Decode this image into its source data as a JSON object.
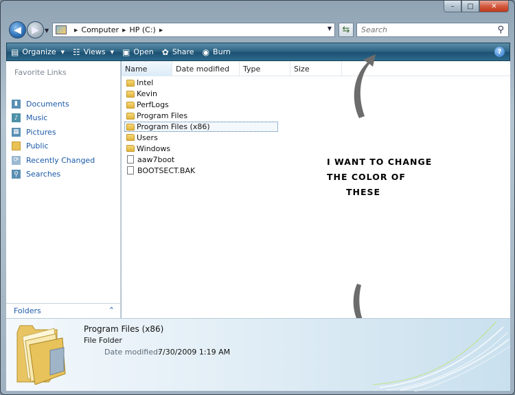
{
  "window": {
    "caption": {
      "minimize": "–",
      "maximize": "□",
      "close": "✕"
    }
  },
  "address_bar": {
    "breadcrumbs": [
      "Computer",
      "HP (C:)"
    ],
    "search_placeholder": "Search"
  },
  "toolbar": {
    "items": [
      {
        "label": "Organize",
        "icon": "organize-icon",
        "dropdown": true
      },
      {
        "label": "Views",
        "icon": "views-icon",
        "dropdown": true
      },
      {
        "label": "Open",
        "icon": "open-icon",
        "dropdown": false
      },
      {
        "label": "Share",
        "icon": "share-icon",
        "dropdown": false
      },
      {
        "label": "Burn",
        "icon": "burn-icon",
        "dropdown": false
      }
    ],
    "help": "?"
  },
  "nav_pane": {
    "title": "Favorite Links",
    "links": [
      {
        "label": "Documents",
        "icon": "documents-icon"
      },
      {
        "label": "Music",
        "icon": "music-icon"
      },
      {
        "label": "Pictures",
        "icon": "pictures-icon"
      },
      {
        "label": "Public",
        "icon": "public-folder-icon"
      },
      {
        "label": "Recently Changed",
        "icon": "recently-changed-icon"
      },
      {
        "label": "Searches",
        "icon": "searches-icon"
      }
    ],
    "folders_label": "Folders"
  },
  "file_list": {
    "columns": [
      "Name",
      "Date modified",
      "Type",
      "Size"
    ],
    "items": [
      {
        "name": "Intel",
        "kind": "folder",
        "selected": false
      },
      {
        "name": "Kevin",
        "kind": "folder",
        "selected": false
      },
      {
        "name": "PerfLogs",
        "kind": "folder",
        "selected": false
      },
      {
        "name": "Program Files",
        "kind": "folder",
        "selected": false
      },
      {
        "name": "Program Files (x86)",
        "kind": "folder",
        "selected": true
      },
      {
        "name": "Users",
        "kind": "folder",
        "selected": false
      },
      {
        "name": "Windows",
        "kind": "folder",
        "selected": false
      },
      {
        "name": "aaw7boot",
        "kind": "file",
        "selected": false
      },
      {
        "name": "BOOTSECT.BAK",
        "kind": "file",
        "selected": false
      }
    ]
  },
  "annotation": {
    "lines": [
      "I want to change",
      "the color of",
      "these"
    ]
  },
  "details_pane": {
    "name": "Program Files (x86)",
    "type": "File Folder",
    "date_label": "Date modified:",
    "date_value": "7/30/2009 1:19 AM"
  }
}
